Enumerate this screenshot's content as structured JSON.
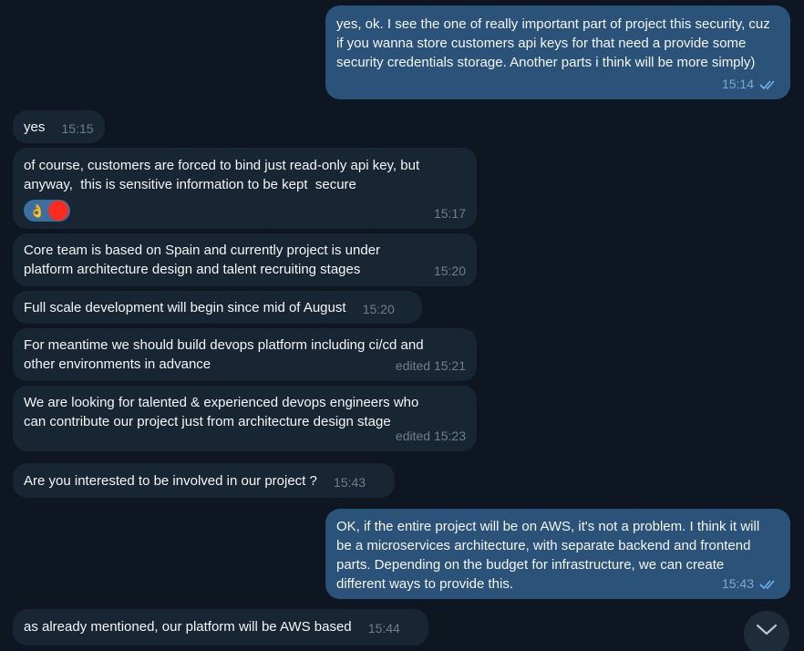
{
  "messages": [
    {
      "id": "m1",
      "direction": "outgoing",
      "text": "yes, ok. I see the one of really important part of project this security, cuz if you wanna store customers api keys for that need a provide some security credentials storage. Another parts i think will be more simply)",
      "time": "15:14",
      "read": true
    },
    {
      "id": "m2",
      "direction": "incoming",
      "text": "yes",
      "time": "15:15"
    },
    {
      "id": "m3",
      "direction": "incoming",
      "text": "of course, customers are forced to bind just read-only api key, but anyway,  this is sensitive information to be kept  secure",
      "time": "15:17",
      "reaction": {
        "emoji": "👌"
      }
    },
    {
      "id": "m4",
      "direction": "incoming",
      "text": "Core team is based on Spain and currently project is under platform architecture design and talent recruiting stages",
      "time": "15:20"
    },
    {
      "id": "m5",
      "direction": "incoming",
      "text": "Full scale development will begin since mid of August",
      "time": "15:20"
    },
    {
      "id": "m6",
      "direction": "incoming",
      "text": "For meantime we should build devops platform including ci/cd and other environments in advance",
      "time": "edited 15:21"
    },
    {
      "id": "m7",
      "direction": "incoming",
      "text": "We are looking for talented & experienced devops engineers who can contribute our project just from architecture design stage",
      "time": "edited 15:23"
    },
    {
      "id": "m8",
      "direction": "incoming",
      "text": "Are you interested to be involved in our project ?",
      "time": "15:43"
    },
    {
      "id": "m9",
      "direction": "outgoing",
      "text": "OK, if the entire project will be on AWS, it's not a problem. I think it will be a microservices architecture, with separate backend and frontend parts. Depending on the budget for infrastructure, we can create different ways to provide this.",
      "time": "15:43",
      "read": true
    },
    {
      "id": "m10",
      "direction": "incoming",
      "text": "as already mentioned, our platform will be AWS based",
      "time": "15:44"
    }
  ],
  "colors": {
    "background": "#0e1621",
    "incoming_bubble": "#182533",
    "outgoing_bubble": "#2b5278",
    "check_color": "#6fb3f3",
    "reaction_avatar": "#ff2a1e"
  },
  "icons": {
    "read_receipt": "double-check-icon",
    "scroll_down": "chevron-down-icon"
  }
}
